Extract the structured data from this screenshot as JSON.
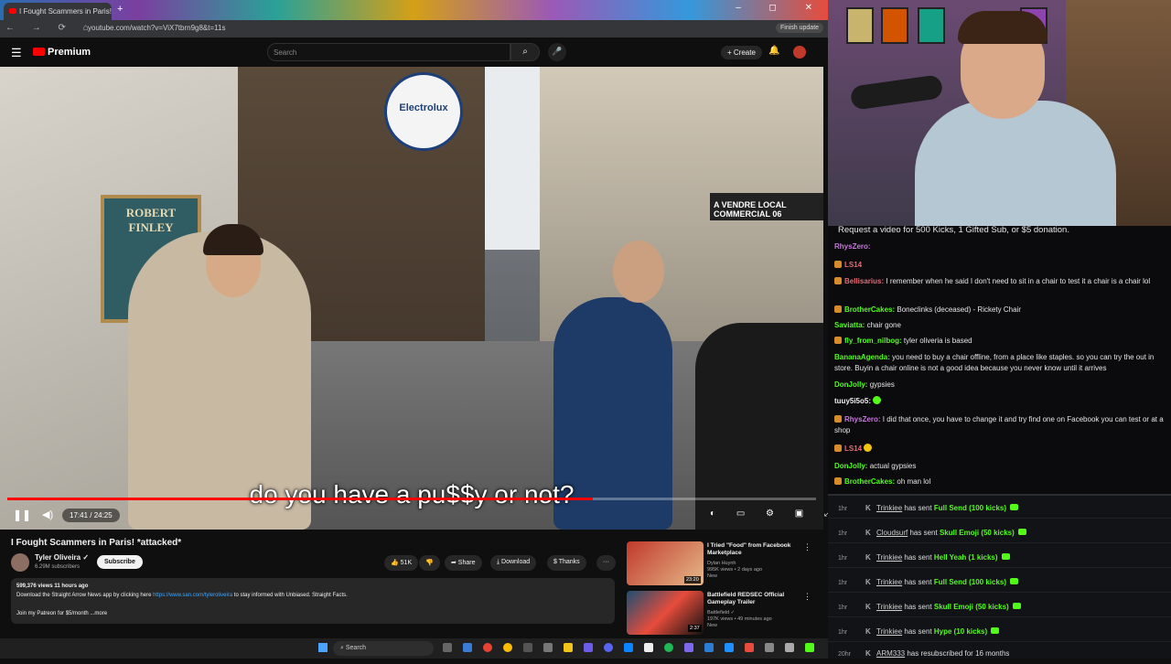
{
  "browser": {
    "tab_title": "I Fought Scammers in Paris!",
    "tab_new": "+",
    "window_controls": "– ◻ ✕",
    "nav_icons": "← → ⟳ ⌂",
    "url": "youtube.com/watch?v=ViX7tbrn9g8&t=11s",
    "finish_update": "Finish update"
  },
  "youtube": {
    "menu_icon": "☰",
    "logo_text": "Premium",
    "search_placeholder": "Search",
    "search_icon": "⌕",
    "mic_icon": "🎤",
    "create_label": "+ Create",
    "bell_icon": "🔔"
  },
  "video": {
    "subtitle": "do you have a pu$$y or not?",
    "time": "17:41 / 24:25",
    "progress": 0.724,
    "pause_icon": "❚❚",
    "volume_icon": "◀)",
    "controls_right": "◐ ▭ ⚙ ▣ ⤢",
    "sign_electrolux": "Electrolux",
    "poster_text": "ROBERT FINLEY",
    "shop_sign": "A VENDRE LOCAL COMMERCIAL 06"
  },
  "info": {
    "title": "I Fought Scammers in Paris! *attacked*",
    "channel": "Tyler Oliveira ✓",
    "subscribers": "6.29M subscribers",
    "subscribe": "Subscribe",
    "likes": "👍 51K",
    "dislike": "👎",
    "share": "➦ Share",
    "download": "⤓ Download",
    "thanks": "$ Thanks",
    "more": "···",
    "stats": "599,376 views  11 hours ago",
    "desc_pre": "Download the Straight Arrow News app by clicking here ",
    "desc_link": "https://www.san.com/tyleroliveira",
    "desc_post": " to stay informed with Unbiased. Straight Facts.",
    "patreon": "Join my Patreon for $5/month   ...more"
  },
  "recommendations": [
    {
      "title": "I Tried \"Food\" from Facebook Marketplace",
      "channel": "Dylan Huynh",
      "meta": "995K views • 2 days ago",
      "badge": "New",
      "duration": "23:20"
    },
    {
      "title": "Battlefield REDSEC Official Gameplay Trailer",
      "channel": "Battlefield ✓",
      "meta": "197K views • 49 minutes ago",
      "badge": "New",
      "duration": "2:37"
    }
  ],
  "chat": {
    "banner": "Request a video for 500 Kicks, 1 Gifted Sub, or $5 donation.",
    "messages": [
      {
        "user": "RhysZero:",
        "text": "",
        "color": "#c678dd"
      },
      {
        "user": "LS14",
        "text": "",
        "color": "#e06c75"
      },
      {
        "user": "Bellisarius:",
        "text": "I remember when he said I don't need to sit in a chair to test it a chair is a chair lol",
        "color": "#e06c75"
      },
      {
        "user": "BrotherCakes:",
        "text": "Boneclinks (deceased) - Rickety Chair",
        "color": "#53fc18"
      },
      {
        "user": "Saviatta:",
        "text": "chair gone",
        "color": "#53fc18"
      },
      {
        "user": "fly_from_nilbog:",
        "text": "tyler oliveria is based",
        "color": "#53fc18"
      },
      {
        "user": "BananaAgenda:",
        "text": "you need to buy a chair offline, from a place like staples. so you can try the out in store. Buyin a chair online is not a good idea because you never know until it arrives",
        "color": "#53fc18"
      },
      {
        "user": "DonJolly:",
        "text": "gypsies",
        "color": "#53fc18"
      },
      {
        "user": "tuuy5i5o5:",
        "text": "",
        "color": "#f1f1f1"
      },
      {
        "user": "RhysZero:",
        "text": "I did that once, you have to change it and try find one on Facebook you can test or at a shop",
        "color": "#c678dd"
      },
      {
        "user": "LS14",
        "text": "",
        "color": "#e06c75"
      },
      {
        "user": "DonJolly:",
        "text": "actual gypsies",
        "color": "#53fc18"
      },
      {
        "user": "BrotherCakes:",
        "text": "oh man lol",
        "color": "#53fc18"
      }
    ]
  },
  "events": [
    {
      "age": "1hr",
      "user": "Trinkiee",
      "verb": "has sent",
      "gift": "Full Send (100 kicks)"
    },
    {
      "age": "1hr",
      "user": "Cloudsurf",
      "verb": "has sent",
      "gift": "Skull Emoji (50 kicks)"
    },
    {
      "age": "1hr",
      "user": "Trinkiee",
      "verb": "has sent",
      "gift": "Hell Yeah (1 kicks)"
    },
    {
      "age": "1hr",
      "user": "Trinkiee",
      "verb": "has sent",
      "gift": "Full Send (100 kicks)"
    },
    {
      "age": "1hr",
      "user": "Trinkiee",
      "verb": "has sent",
      "gift": "Skull Emoji (50 kicks)"
    },
    {
      "age": "1hr",
      "user": "Trinkiee",
      "verb": "has sent",
      "gift": "Hype (10 kicks)"
    },
    {
      "age": "20hr",
      "user": "ARM333",
      "verb": "has resubscribed for 16 months",
      "gift": ""
    }
  ],
  "taskbar": {
    "search": "⌕ Search"
  }
}
